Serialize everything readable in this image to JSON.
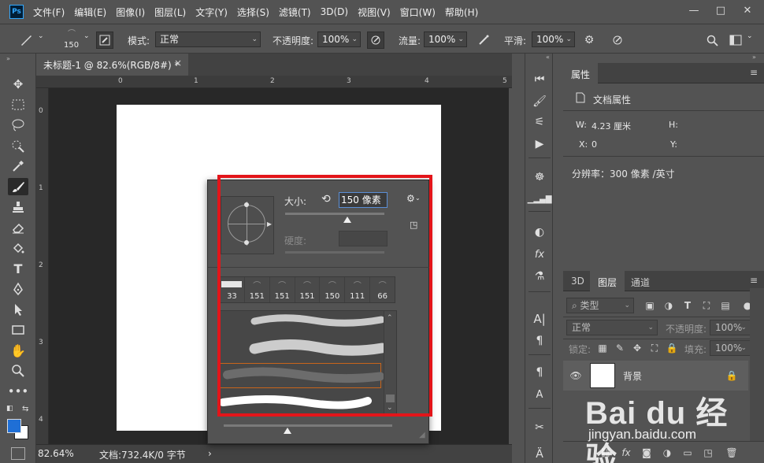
{
  "app": {
    "logo_text": "Ps"
  },
  "menu": [
    "文件(F)",
    "编辑(E)",
    "图像(I)",
    "图层(L)",
    "文字(Y)",
    "选择(S)",
    "滤镜(T)",
    "3D(D)",
    "视图(V)",
    "窗口(W)",
    "帮助(H)"
  ],
  "window_controls": {
    "minimize": "—",
    "restore": "□",
    "close": "✕"
  },
  "options": {
    "brush_size": "150",
    "mode_label": "模式:",
    "mode_value": "正常",
    "opacity_label": "不透明度:",
    "opacity_value": "100%",
    "flow_label": "流量:",
    "flow_value": "100%",
    "smoothing_label": "平滑:",
    "smoothing_value": "100%"
  },
  "document": {
    "tab_title": "未标题-1 @ 82.6%(RGB/8#) *",
    "tab_close": "×",
    "ruler_h": [
      "0",
      "1",
      "2",
      "3",
      "4",
      "5"
    ],
    "ruler_v": [
      "0",
      "1",
      "2",
      "3",
      "4"
    ],
    "zoom": "82.64%",
    "doc_info": "文档:732.4K/0 字节",
    "status_arrow": "›"
  },
  "brush_picker": {
    "size_label": "大小:",
    "size_value": "150 像素",
    "hardness_label": "硬度:",
    "presets": [
      "33",
      "151",
      "151",
      "151",
      "150",
      "111",
      "66"
    ],
    "preset_glyph": "⌒"
  },
  "properties_panel": {
    "tab": "属性",
    "section": "文档属性",
    "w_label": "W:",
    "w_value": "4.23 厘米",
    "h_label": "H:",
    "x_label": "X:",
    "x_value": "0",
    "y_label": "Y:",
    "resolution": "分辨率：300 像素 /英寸"
  },
  "layers_panel": {
    "tabs": [
      "3D",
      "图层",
      "通道"
    ],
    "filter_kind": "类型",
    "blend_mode": "正常",
    "opacity_label": "不透明度:",
    "opacity_value": "100%",
    "lock_label": "锁定:",
    "fill_label": "填充:",
    "fill_value": "100%",
    "layer_name": "背景"
  },
  "watermark": {
    "logo": "Bai du 经验",
    "url": "jingyan.baidu.com"
  },
  "colors": {
    "accent_blue": "#1f6fd6",
    "highlight_red": "#e3151a",
    "selection_orange": "#c8651b"
  }
}
